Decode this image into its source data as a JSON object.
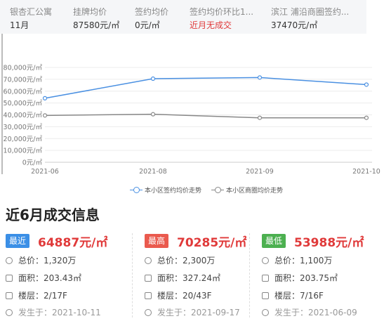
{
  "stats": [
    {
      "label": "银杏汇公寓",
      "value": "11月",
      "color": "normal"
    },
    {
      "label": "挂牌均价",
      "value": "87580元/㎡",
      "color": "normal"
    },
    {
      "label": "签约均价",
      "value": "0元/㎡",
      "color": "normal"
    },
    {
      "label": "签约均价环比1...",
      "value": "近月无成交",
      "color": "red"
    },
    {
      "label": "滨江 浦沿商圈签约...",
      "value": "37470元/㎡",
      "color": "normal"
    }
  ],
  "chart_data": {
    "type": "line",
    "x": [
      "2021-06",
      "2021-08",
      "2021-09",
      "2021-10"
    ],
    "y_ticks": [
      "80,000元/㎡",
      "70,000元/㎡",
      "60,000元/㎡",
      "50,000元/㎡",
      "40,000元/㎡",
      "30,000元/㎡",
      "20,000元/㎡",
      "10,000元/㎡",
      "0元/㎡"
    ],
    "ylim": [
      0,
      80000
    ],
    "series": [
      {
        "name": "本小区签约均价走势",
        "color": "#4a90e2",
        "values": [
          54000,
          70500,
          71500,
          65500
        ]
      },
      {
        "name": "本小区商圈均价走势",
        "color": "#888888",
        "values": [
          39500,
          40500,
          37500,
          37500
        ]
      }
    ],
    "grid": true,
    "legend": "bottom"
  },
  "section_title": "近6月成交信息",
  "cards": [
    {
      "badge": "最近",
      "badge_color": "#3b8fe6",
      "price": "64887元/㎡",
      "total_label": "总价：",
      "total": "1,320万",
      "area_label": "面积：",
      "area": "203.43㎡",
      "floor_label": "楼层：",
      "floor": "2/17F",
      "date_label": "发生于：",
      "date": "2021-10-11"
    },
    {
      "badge": "最高",
      "badge_color": "#ea5a4e",
      "price": "70285元/㎡",
      "total_label": "总价：",
      "total": "2,300万",
      "area_label": "面积：",
      "area": "327.24㎡",
      "floor_label": "楼层：",
      "floor": "20/43F",
      "date_label": "发生于：",
      "date": "2021-09-17"
    },
    {
      "badge": "最低",
      "badge_color": "#4cb050",
      "price": "53988元/㎡",
      "total_label": "总价：",
      "total": "1,100万",
      "area_label": "面积：",
      "area": "203.75㎡",
      "floor_label": "楼层：",
      "floor": "7/16F",
      "date_label": "发生于：",
      "date": "2021-06-09"
    }
  ],
  "icons": {
    "total": "yen-icon",
    "area": "area-icon",
    "floor": "layers-icon",
    "date": "clock-icon"
  }
}
